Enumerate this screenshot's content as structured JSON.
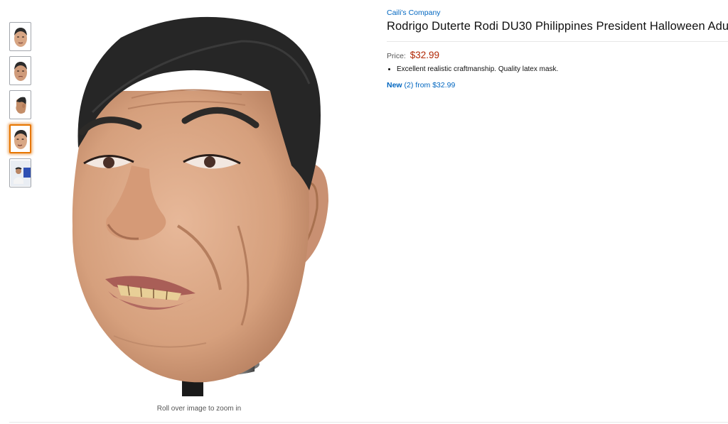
{
  "product": {
    "brand": "Caili's Company",
    "title": "Rodrigo Duterte Rodi DU30 Philippines President Halloween Adu",
    "price_label": "Price:",
    "price": "$32.99",
    "bullets": [
      "Excellent realistic craftmanship. Quality latex mask."
    ],
    "offers": {
      "condition": "New",
      "count": "(2)",
      "from_text": "from $32.99"
    }
  },
  "gallery": {
    "zoom_hint": "Roll over image to zoom in",
    "thumbnails": [
      {
        "name": "mask-front"
      },
      {
        "name": "mask-front-alt"
      },
      {
        "name": "mask-side"
      },
      {
        "name": "mask-angle"
      },
      {
        "name": "person-photo"
      }
    ],
    "selected_index": 3
  },
  "colors": {
    "link": "#0066c0",
    "price": "#b12704",
    "selected_thumb": "#e77600"
  }
}
